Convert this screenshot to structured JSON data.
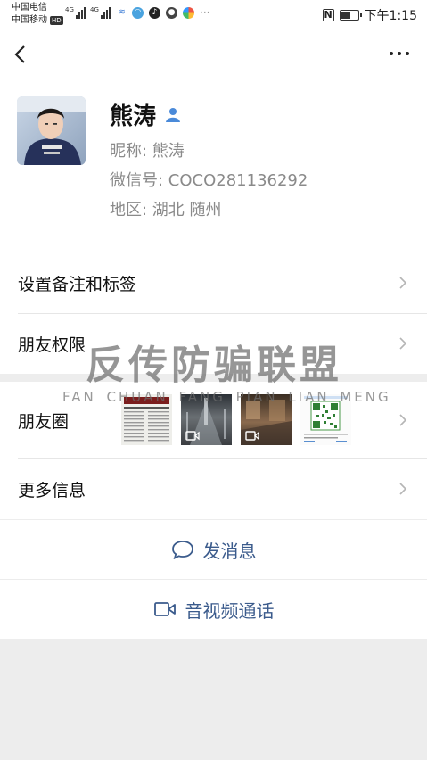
{
  "status_bar": {
    "carrier_1": "中国电信",
    "carrier_2": "中国移动",
    "hd_badge": "HD",
    "net_1": "4G",
    "net_2": "4G",
    "more_dots": "···",
    "time": "下午1:15",
    "nfc_label": "N",
    "battery_level": 0.62
  },
  "navbar": {
    "back_icon": "chevron-left-icon",
    "more_icon": "more-dots-icon"
  },
  "profile": {
    "name": "熊涛",
    "nickname": "昵称: 熊涛",
    "wechat_id": "微信号: COCO281136292",
    "region": "地区: 湖北  随州",
    "gender_icon": "person-icon",
    "accent_color": "#4a8ad9"
  },
  "menu": {
    "remark_tags": "设置备注和标签",
    "friend_permissions": "朋友权限",
    "moments": "朋友圈",
    "more_info": "更多信息"
  },
  "moments_thumbs": [
    {
      "kind": "newspaper"
    },
    {
      "kind": "video"
    },
    {
      "kind": "video"
    },
    {
      "kind": "qr-code"
    }
  ],
  "actions": {
    "send_message": "发消息",
    "video_call": "音视频通话",
    "color": "#3b5b8c"
  },
  "watermark": {
    "title": "反传防骗联盟",
    "subtitle": "FAN CHUAN FANG PIAN LIAN MENG"
  }
}
